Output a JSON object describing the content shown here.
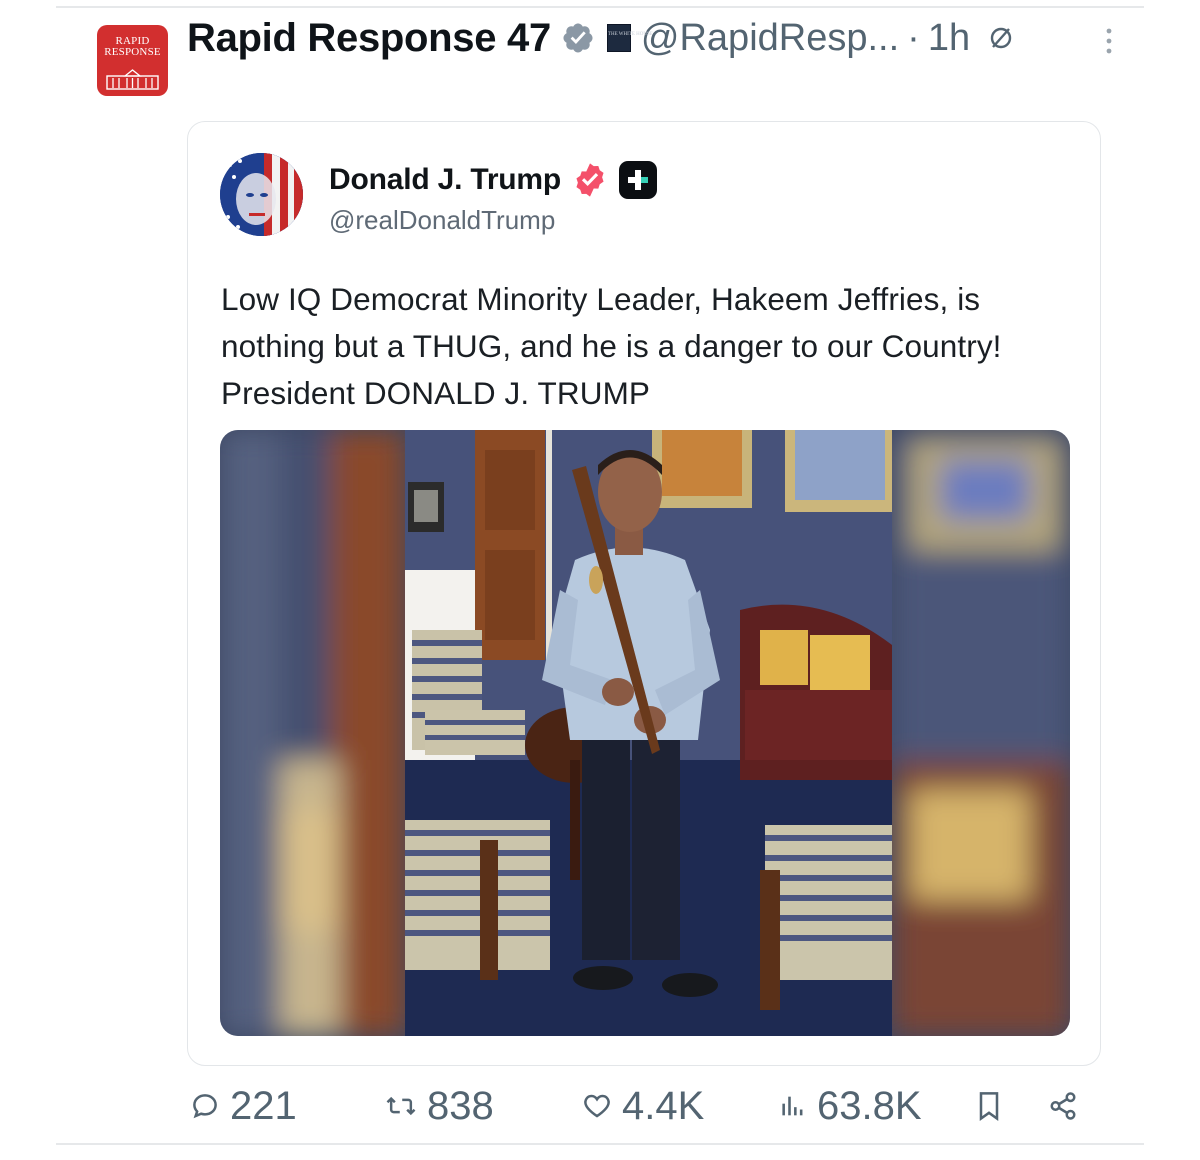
{
  "post": {
    "author_name": "Rapid Response 47",
    "author_handle": "@RapidResp...",
    "separator": "·",
    "time": "1h",
    "avatar_text_line1": "RAPID",
    "avatar_text_line2": "RESPONSE",
    "affiliation_badge_text": "THE WHITE HOUSE"
  },
  "quoted": {
    "name": "Donald J. Trump",
    "handle": "@realDonaldTrump",
    "text": "Low IQ Democrat Minority Leader, Hakeem Jeffries, is nothing but a THUG, and he is a danger to our Country! President DONALD J. TRUMP"
  },
  "actions": {
    "replies": "221",
    "reposts": "838",
    "likes": "4.4K",
    "views": "63.8K"
  },
  "colors": {
    "text_primary": "#0f1419",
    "text_secondary": "#536471",
    "verified_blue": "#8b98a5",
    "verified_pink": "#f4506a",
    "rr_red": "#d22f2f"
  },
  "icons": [
    "verified-badge-icon",
    "white-house-badge-icon",
    "no-edit-icon",
    "more-icon",
    "pink-verified-icon",
    "truth-plus-icon",
    "reply-icon",
    "repost-icon",
    "like-icon",
    "views-icon",
    "bookmark-icon",
    "share-icon"
  ]
}
